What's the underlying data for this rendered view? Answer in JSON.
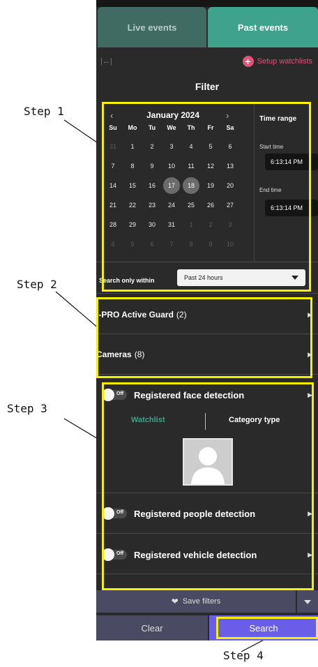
{
  "tabs": {
    "live": "Live events",
    "past": "Past events"
  },
  "header": {
    "expand_glyph": "|↔|",
    "setup_label": "Setup watchlists",
    "filter_title": "Filter"
  },
  "calendar": {
    "month_label": "January 2024",
    "prev": "‹",
    "next": "›",
    "weekdays": [
      "Su",
      "Mo",
      "Tu",
      "We",
      "Th",
      "Fr",
      "Sa"
    ],
    "weeks": [
      [
        "31",
        "1",
        "2",
        "3",
        "4",
        "5",
        "6"
      ],
      [
        "7",
        "8",
        "9",
        "10",
        "11",
        "12",
        "13"
      ],
      [
        "14",
        "15",
        "16",
        "17",
        "18",
        "19",
        "20"
      ],
      [
        "21",
        "22",
        "23",
        "24",
        "25",
        "26",
        "27"
      ],
      [
        "28",
        "29",
        "30",
        "31",
        "1",
        "2",
        "3"
      ],
      [
        "4",
        "5",
        "6",
        "7",
        "8",
        "9",
        "10"
      ]
    ],
    "selected": [
      "17",
      "18"
    ]
  },
  "time_range": {
    "title": "Time range",
    "start_label": "Start time",
    "start_value": "6:13:14 PM",
    "end_label": "End time",
    "end_value": "6:13:14 PM"
  },
  "search_within": {
    "label": "Search only within",
    "value": "Past 24 hours"
  },
  "groups": [
    {
      "label": "i-PRO Active Guard",
      "count": "(2)"
    },
    {
      "label": "Cameras",
      "count": "(8)"
    }
  ],
  "detections": {
    "toggle_off": "Off",
    "face": "Registered face detection",
    "people": "Registered people detection",
    "vehicle": "Registered vehicle detection",
    "watchlist_tab": "Watchlist",
    "category_tab": "Category type"
  },
  "actions": {
    "save": "Save filters",
    "clear": "Clear",
    "search": "Search"
  },
  "annotations": {
    "step1": "Step 1",
    "step2": "Step 2",
    "step3": "Step 3",
    "step4": "Step 4"
  },
  "colors": {
    "accent": "#3fa28c",
    "highlight": "#f4f000",
    "search": "#6a5de8",
    "pink": "#e0527b"
  }
}
